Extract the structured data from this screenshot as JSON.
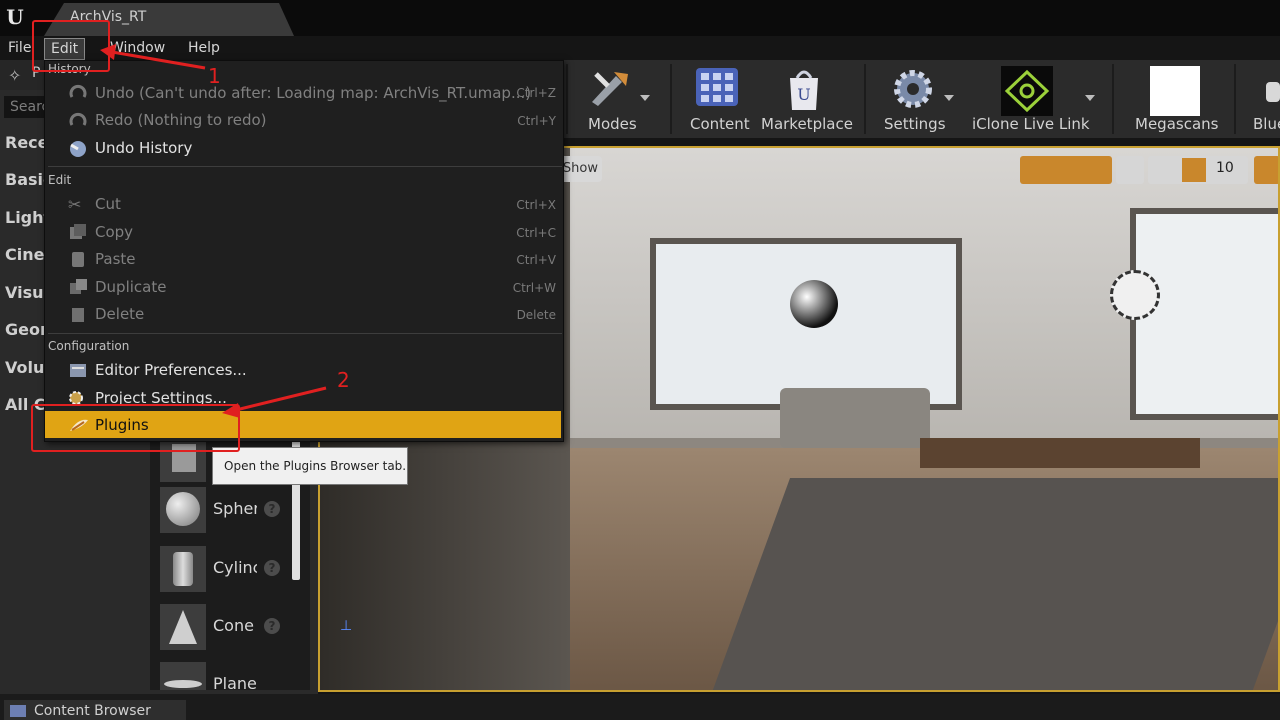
{
  "window": {
    "doc_tab": "ArchVis_RT"
  },
  "menubar": {
    "file": "File",
    "edit": "Edit",
    "window": "Window",
    "help": "Help"
  },
  "left_panel": {
    "modes_label": "P",
    "search_placeholder": "Searc",
    "categories": [
      "Rece",
      "Basic",
      "Light",
      "Cine",
      "Visua",
      "Geon",
      "Volu",
      "All C"
    ],
    "assets": [
      {
        "label": "Spher"
      },
      {
        "label": "Cylinc"
      },
      {
        "label": "Cone"
      },
      {
        "label": "Plane"
      }
    ]
  },
  "toolbar": {
    "modes": "Modes",
    "content": "Content",
    "marketplace": "Marketplace",
    "settings": "Settings",
    "iclone": "iClone Live Link",
    "megascans": "Megascans",
    "blueprints": "Blue"
  },
  "viewport": {
    "show_label": "Show",
    "grid_snap_value": "10"
  },
  "edit_menu": {
    "history_header": "History",
    "undo": "Undo (Can't undo after: Loading map: ArchVis_RT.umap...)",
    "undo_shortcut": "Ctrl+Z",
    "redo": "Redo (Nothing to redo)",
    "redo_shortcut": "Ctrl+Y",
    "undo_history": "Undo History",
    "edit_header": "Edit",
    "cut": "Cut",
    "cut_shortcut": "Ctrl+X",
    "copy": "Copy",
    "copy_shortcut": "Ctrl+C",
    "paste": "Paste",
    "paste_shortcut": "Ctrl+V",
    "duplicate": "Duplicate",
    "duplicate_shortcut": "Ctrl+W",
    "delete": "Delete",
    "delete_shortcut": "Delete",
    "config_header": "Configuration",
    "editor_preferences": "Editor Preferences...",
    "project_settings": "Project Settings...",
    "plugins": "Plugins",
    "plugins_tooltip": "Open the Plugins Browser tab."
  },
  "annotations": {
    "step1": "1",
    "step2": "2"
  },
  "bottom": {
    "content_browser": "Content Browser"
  },
  "colors": {
    "highlight": "#e0a414",
    "annotation": "#e02020",
    "viewport_border": "#c8a030"
  }
}
